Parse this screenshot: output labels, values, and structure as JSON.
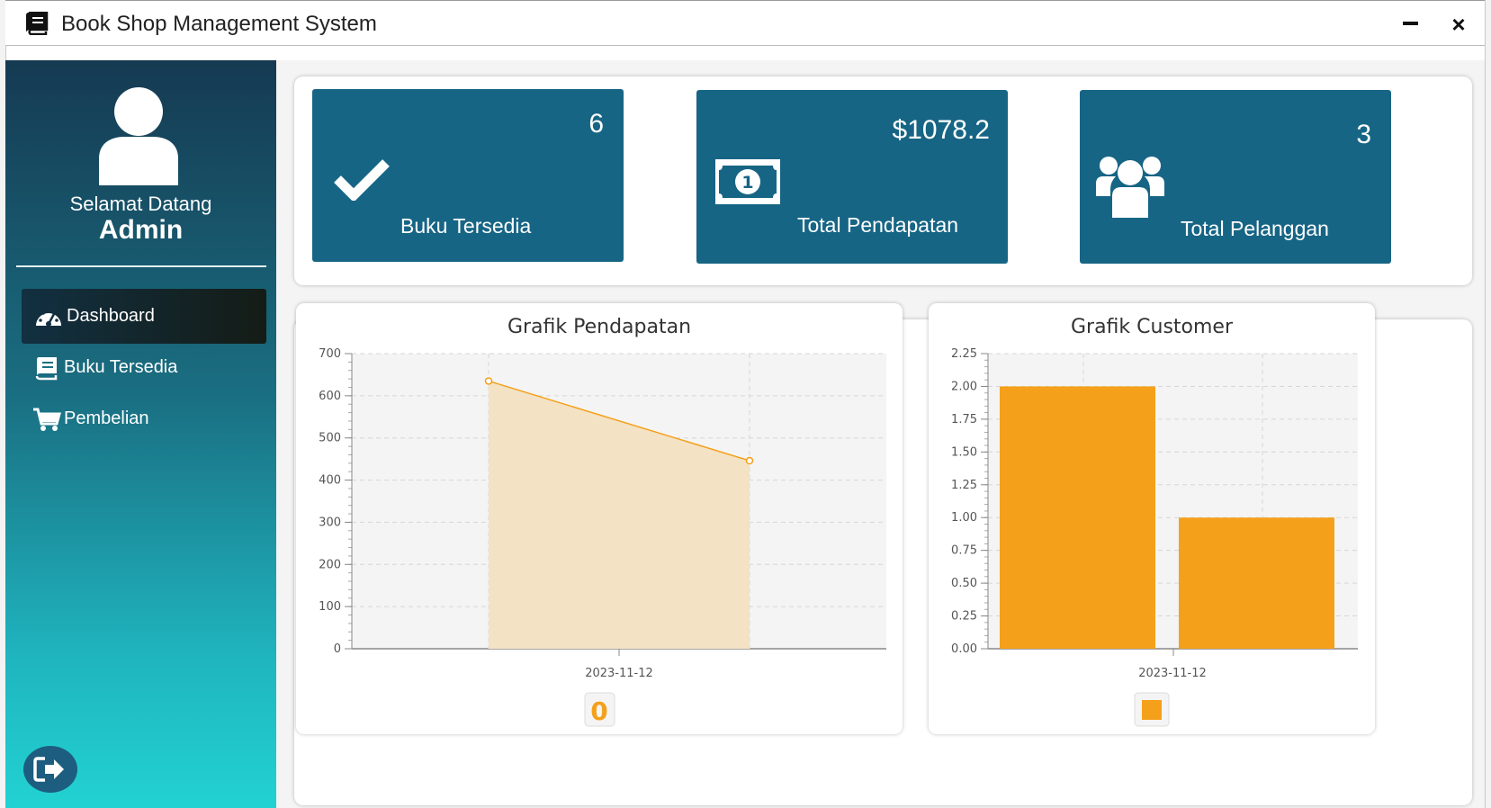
{
  "window": {
    "title": "Book Shop Management System",
    "minimize_icon": "minimize-icon",
    "close_icon": "×"
  },
  "sidebar": {
    "welcome": "Selamat Datang",
    "role": "Admin",
    "items": [
      {
        "label": "Dashboard",
        "icon": "dashboard-icon",
        "active": true
      },
      {
        "label": "Buku Tersedia",
        "icon": "book-icon",
        "active": false
      },
      {
        "label": "Pembelian",
        "icon": "cart-icon",
        "active": false
      }
    ],
    "logout_icon": "logout-icon"
  },
  "stats": [
    {
      "value": "6",
      "label": "Buku Tersedia",
      "icon": "check-icon"
    },
    {
      "value": "$1078.2",
      "label": "Total Pendapatan",
      "icon": "money-icon"
    },
    {
      "value": "3",
      "label": "Total Pelanggan",
      "icon": "users-icon"
    }
  ],
  "colors": {
    "card": "#176585",
    "accent": "#f5a01a",
    "area_fill": "#f4e2c5"
  },
  "chart_data": [
    {
      "type": "area",
      "title": "Grafik Pendapatan",
      "x": [
        "",
        ""
      ],
      "xtick": "2023-11-12",
      "values": [
        635,
        446
      ],
      "ylim": [
        0,
        700
      ],
      "yticks": [
        0,
        100,
        200,
        300,
        400,
        500,
        600,
        700
      ],
      "grid": true,
      "legend": {
        "marker": "0"
      }
    },
    {
      "type": "bar",
      "title": "Grafik Customer",
      "xtick": "2023-11-12",
      "values": [
        2,
        1
      ],
      "ylim": [
        0,
        2.25
      ],
      "yticks": [
        "0.00",
        "0.25",
        "0.50",
        "0.75",
        "1.00",
        "1.25",
        "1.50",
        "1.75",
        "2.00",
        "2.25"
      ],
      "grid": true,
      "legend": {
        "marker": "square"
      }
    }
  ]
}
